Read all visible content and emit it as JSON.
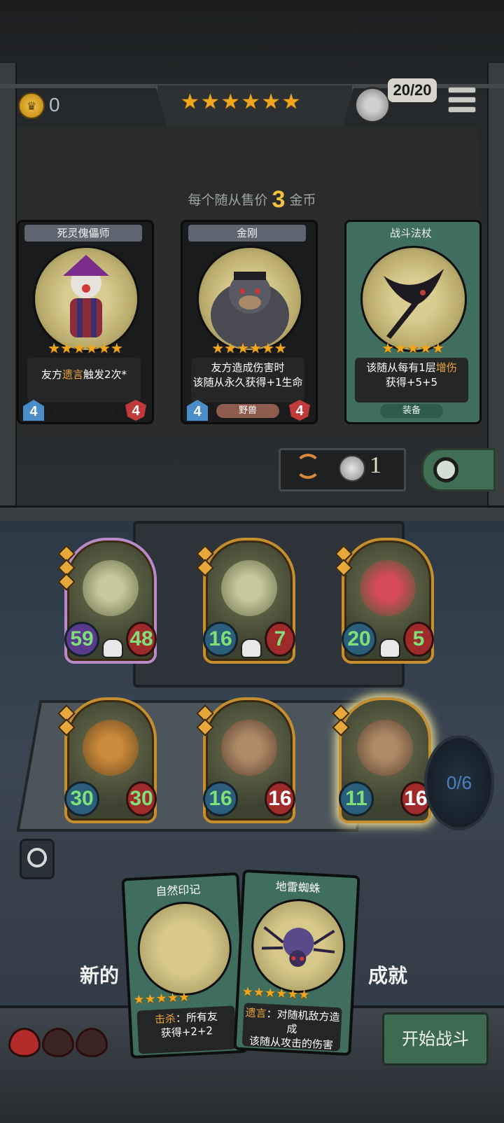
{
  "header": {
    "gold": "0",
    "tier_stars": "★★★★★★",
    "health": "20/20"
  },
  "shop": {
    "sell_prefix": "每个随从售价",
    "sell_amount": "3",
    "sell_suffix": "金币",
    "cards": [
      {
        "name": "死灵傀儡师",
        "stars": "★★★★★★",
        "desc_pre": "友方",
        "desc_hl": "遗言",
        "desc_post": "触发2次*",
        "atk": "4",
        "hp": "4",
        "tag": ""
      },
      {
        "name": "金刚",
        "stars": "★★★★★★",
        "desc_line1": "友方造成伤害时",
        "desc_line2": "该随从永久获得+1生命",
        "atk": "4",
        "hp": "4",
        "tag": "野兽"
      },
      {
        "name": "战斗法杖",
        "stars": "★★★★★",
        "desc_pre": "该随从每有1层",
        "desc_hl": "增伤",
        "desc_line2": "获得+5+5",
        "tag": "装备"
      }
    ],
    "refresh_cost": "1"
  },
  "board": {
    "minions": [
      {
        "atk": "59",
        "hp": "48"
      },
      {
        "atk": "16",
        "hp": "7"
      },
      {
        "atk": "20",
        "hp": "5"
      },
      {
        "atk": "30",
        "hp": "30"
      },
      {
        "atk": "16",
        "hp": "16"
      },
      {
        "atk": "11",
        "hp": "16"
      }
    ],
    "counter": "0/6",
    "achv_left": "新的",
    "achv_right": "成就"
  },
  "hand": [
    {
      "name": "自然印记",
      "stars": "★★★★★",
      "desc_hl": "击杀",
      "desc_line1_post": "：所有友",
      "desc_line2": "获得+2+2"
    },
    {
      "name": "地雷蜘蛛",
      "stars": "★★★★★★",
      "desc_hl": "遗言",
      "desc_line1_post": "：对随机敌方造成",
      "desc_line2": "该随从攻击的伤害"
    }
  ],
  "footer": {
    "start_label": "开始战斗"
  },
  "colors": {
    "star": "#f0a71e",
    "highlight": "#e8a43a",
    "equip_green": "#3f6e5f",
    "hp_red": "#9e2a2a",
    "atk_green_text": "#7fe07a"
  }
}
